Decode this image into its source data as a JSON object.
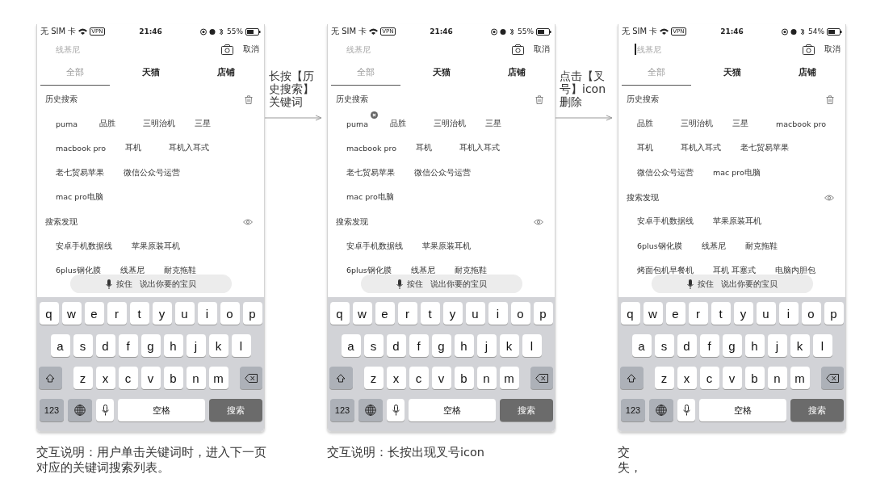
{
  "phones": [
    {
      "status": {
        "carrier": "无 SIM 卡",
        "vpn": "VPN",
        "time": "21:46",
        "battery": "55%"
      },
      "search": {
        "placeholder": "线基尼",
        "focused": false,
        "cancel": "取消"
      },
      "tabs": [
        {
          "label": "全部",
          "selected": true
        },
        {
          "label": "天猫",
          "selected": false
        },
        {
          "label": "店铺",
          "selected": false
        }
      ],
      "history": {
        "title": "历史搜索",
        "rows": [
          [
            {
              "label": "puma",
              "deletable": false
            },
            {
              "label": "品胜",
              "deletable": false
            },
            {
              "label": "三明治机",
              "deletable": false
            },
            {
              "label": "三星",
              "deletable": false
            }
          ],
          [
            {
              "label": "macbook pro",
              "deletable": false
            },
            {
              "label": "耳机",
              "deletable": false
            },
            {
              "label": "耳机入耳式",
              "deletable": false
            }
          ],
          [
            {
              "label": "老七贸易苹果",
              "deletable": false
            },
            {
              "label": "微信公众号运营",
              "deletable": false
            }
          ],
          [
            {
              "label": "mac pro电脑",
              "deletable": false
            }
          ]
        ]
      },
      "discover": {
        "title": "搜索发现",
        "rows": [
          [
            "安卓手机数据线",
            "苹果原装耳机"
          ],
          [
            "6plus钢化膜",
            "线基尼",
            "耐克拖鞋"
          ]
        ]
      },
      "voice": {
        "hold": "按住",
        "hint": "说出你要的宝贝"
      },
      "keyboard": {
        "rows": [
          [
            "q",
            "w",
            "e",
            "r",
            "t",
            "y",
            "u",
            "i",
            "o",
            "p"
          ],
          [
            "a",
            "s",
            "d",
            "f",
            "g",
            "h",
            "j",
            "k",
            "l"
          ],
          [
            "z",
            "x",
            "c",
            "v",
            "b",
            "n",
            "m"
          ]
        ],
        "numbers": "123",
        "space": "空格",
        "go": "搜索"
      },
      "caption": [
        "交互说明：用户单击关键词时，进入下一页",
        "对应的关键词搜索列表。"
      ]
    },
    {
      "status": {
        "carrier": "无 SIM 卡",
        "vpn": "VPN",
        "time": "21:46",
        "battery": "55%"
      },
      "search": {
        "placeholder": "线基尼",
        "focused": false,
        "cancel": "取消"
      },
      "tabs": [
        {
          "label": "全部",
          "selected": true
        },
        {
          "label": "天猫",
          "selected": false
        },
        {
          "label": "店铺",
          "selected": false
        }
      ],
      "history": {
        "title": "历史搜索",
        "rows": [
          [
            {
              "label": "puma",
              "deletable": true
            },
            {
              "label": "品胜",
              "deletable": false
            },
            {
              "label": "三明治机",
              "deletable": false
            },
            {
              "label": "三星",
              "deletable": false
            }
          ],
          [
            {
              "label": "macbook pro",
              "deletable": false
            },
            {
              "label": "耳机",
              "deletable": false
            },
            {
              "label": "耳机入耳式",
              "deletable": false
            }
          ],
          [
            {
              "label": "老七贸易苹果",
              "deletable": false
            },
            {
              "label": "微信公众号运营",
              "deletable": false
            }
          ],
          [
            {
              "label": "mac pro电脑",
              "deletable": false
            }
          ]
        ]
      },
      "discover": {
        "title": "搜索发现",
        "rows": [
          [
            "安卓手机数据线",
            "苹果原装耳机"
          ],
          [
            "6plus钢化膜",
            "线基尼",
            "耐克拖鞋"
          ]
        ]
      },
      "voice": {
        "hold": "按住",
        "hint": "说出你要的宝贝"
      },
      "keyboard": {
        "rows": [
          [
            "q",
            "w",
            "e",
            "r",
            "t",
            "y",
            "u",
            "i",
            "o",
            "p"
          ],
          [
            "a",
            "s",
            "d",
            "f",
            "g",
            "h",
            "j",
            "k",
            "l"
          ],
          [
            "z",
            "x",
            "c",
            "v",
            "b",
            "n",
            "m"
          ]
        ],
        "numbers": "123",
        "space": "空格",
        "go": "搜索"
      },
      "caption": [
        "交互说明：长按出现叉号icon"
      ]
    },
    {
      "status": {
        "carrier": "无 SIM 卡",
        "vpn": "VPN",
        "time": "21:46",
        "battery": "54%"
      },
      "search": {
        "placeholder": "线基尼",
        "focused": true,
        "cancel": "取消"
      },
      "tabs": [
        {
          "label": "全部",
          "selected": true
        },
        {
          "label": "天猫",
          "selected": false
        },
        {
          "label": "店铺",
          "selected": false
        }
      ],
      "history": {
        "title": "历史搜索",
        "rows": [
          [
            {
              "label": "品胜",
              "deletable": false
            },
            {
              "label": "三明治机",
              "deletable": false
            },
            {
              "label": "三星",
              "deletable": false
            },
            {
              "label": "macbook pro",
              "deletable": false
            }
          ],
          [
            {
              "label": "耳机",
              "deletable": false
            },
            {
              "label": "耳机入耳式",
              "deletable": false
            },
            {
              "label": "老七贸易苹果",
              "deletable": false
            }
          ],
          [
            {
              "label": "微信公众号运营",
              "deletable": false
            },
            {
              "label": "mac pro电脑",
              "deletable": false
            }
          ]
        ]
      },
      "discover": {
        "title": "搜索发现",
        "rows": [
          [
            "安卓手机数据线",
            "苹果原装耳机"
          ],
          [
            "6plus钢化膜",
            "线基尼",
            "耐克拖鞋"
          ],
          [
            "烤面包机早餐机",
            "耳机 耳塞式",
            "电脑内胆包"
          ]
        ]
      },
      "voice": {
        "hold": "按住",
        "hint": "说出你要的宝贝"
      },
      "keyboard": {
        "rows": [
          [
            "q",
            "w",
            "e",
            "r",
            "t",
            "y",
            "u",
            "i",
            "o",
            "p"
          ],
          [
            "a",
            "s",
            "d",
            "f",
            "g",
            "h",
            "j",
            "k",
            "l"
          ],
          [
            "z",
            "x",
            "c",
            "v",
            "b",
            "n",
            "m"
          ]
        ],
        "numbers": "123",
        "space": "空格",
        "go": "搜索"
      },
      "caption": [
        "交",
        "失，"
      ]
    }
  ],
  "annotations": [
    {
      "lines": [
        "长按【历",
        "史搜索】",
        "关键词"
      ]
    },
    {
      "lines": [
        "点击【叉",
        "号】icon",
        "删除"
      ]
    }
  ]
}
